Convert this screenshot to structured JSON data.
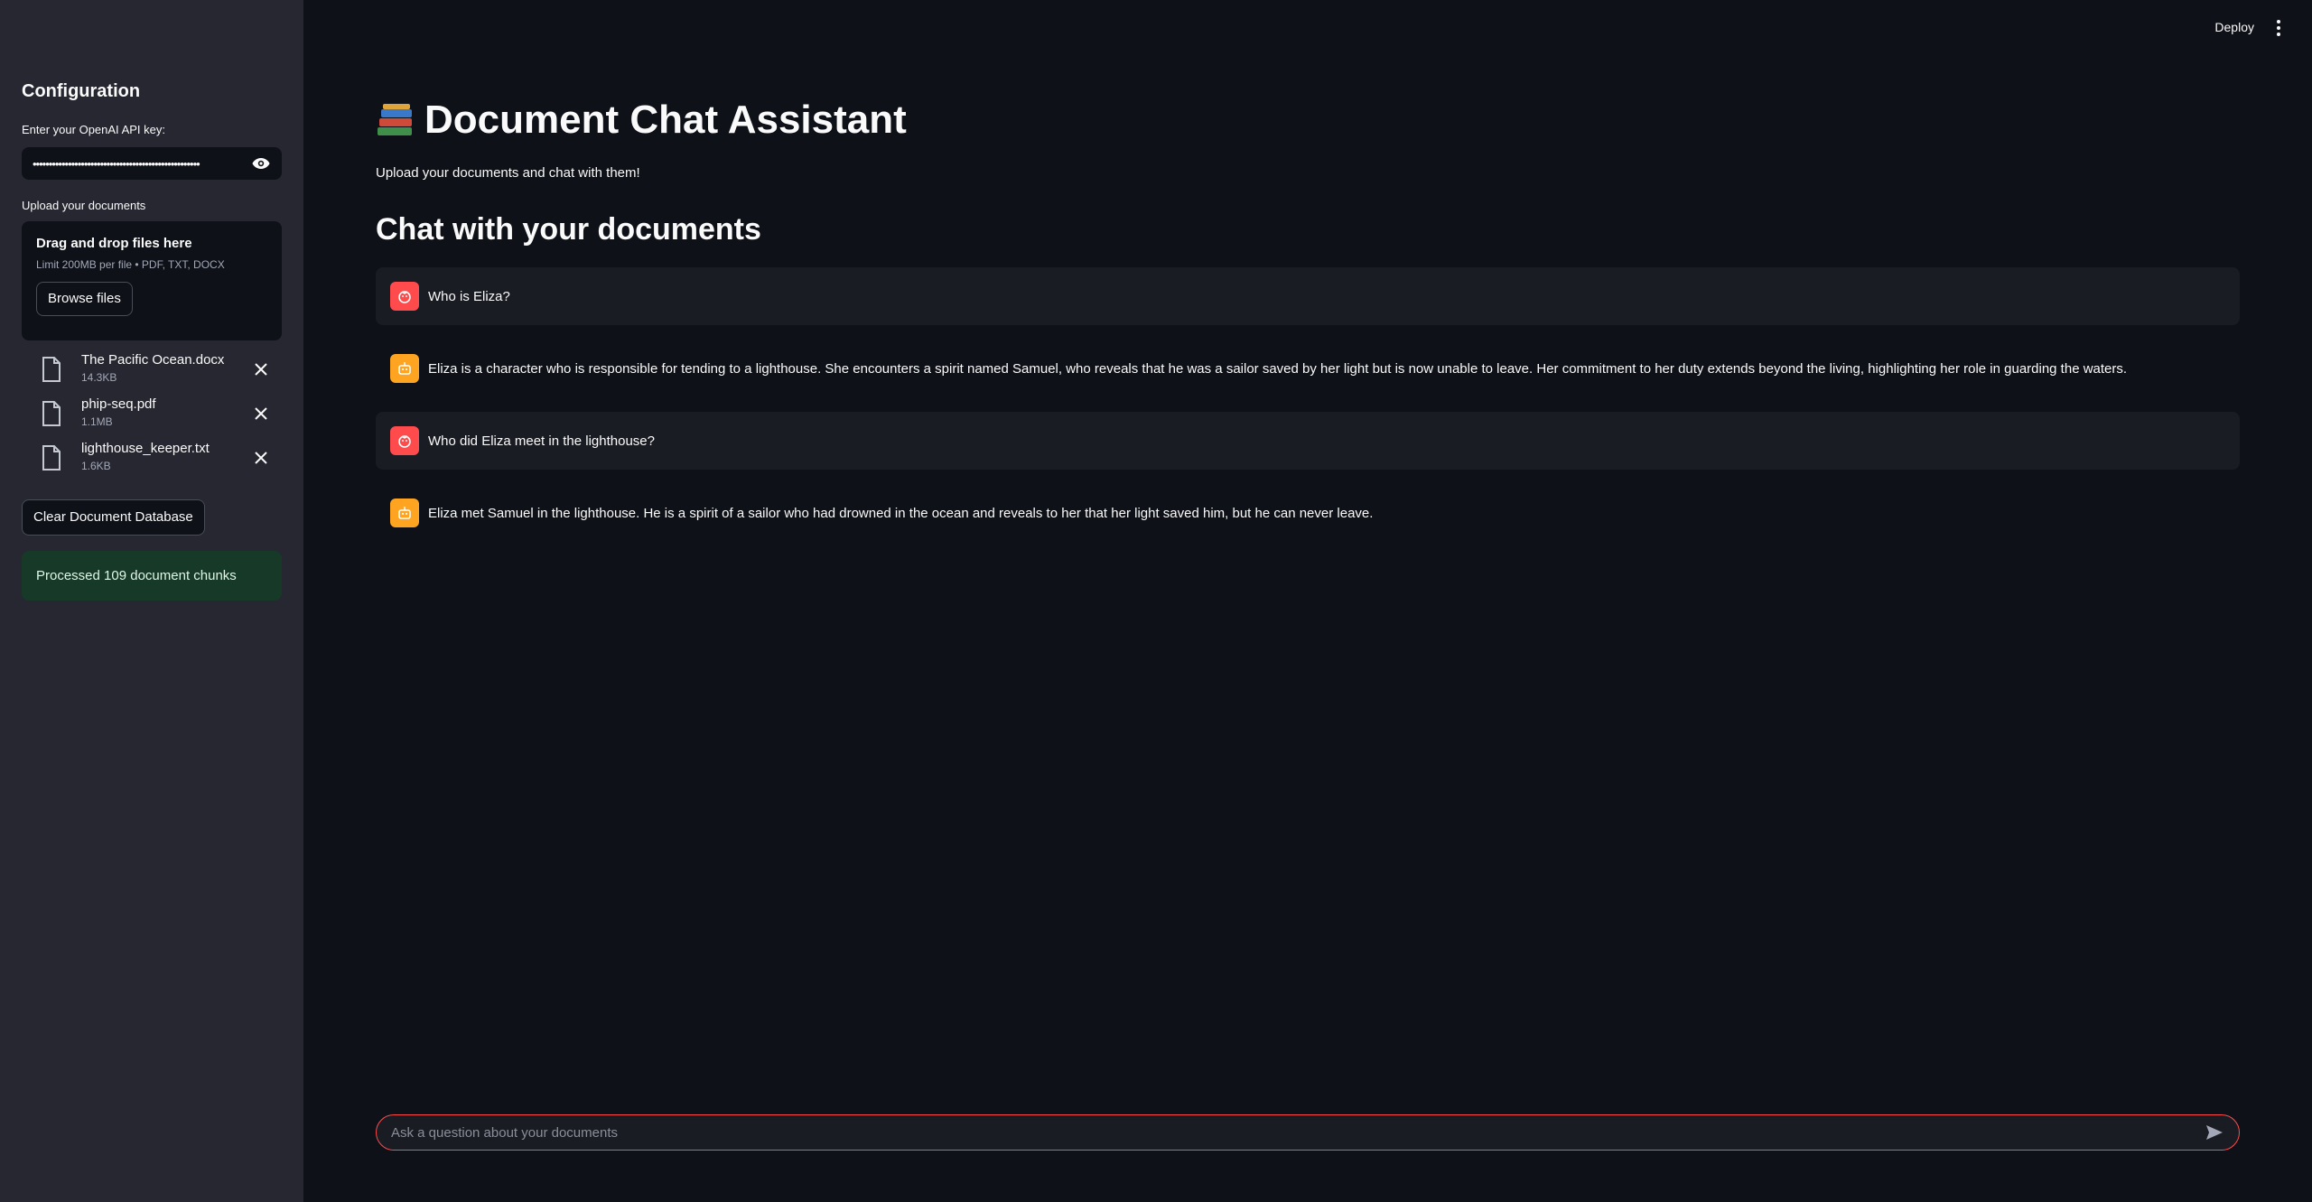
{
  "header": {
    "deploy_label": "Deploy",
    "menu_icon": "kebab-menu-icon"
  },
  "sidebar": {
    "title": "Configuration",
    "api_key_label": "Enter your OpenAI API key:",
    "api_key_value": "••••••••••••••••••••••••••••••••••••••••••••••••••••",
    "upload_label": "Upload your documents",
    "dropzone_title": "Drag and drop files here",
    "dropzone_limit": "Limit 200MB per file • PDF, TXT, DOCX",
    "browse_label": "Browse files",
    "files": [
      {
        "name": "The Pacific Ocean.docx",
        "size": "14.3KB"
      },
      {
        "name": "phip-seq.pdf",
        "size": "1.1MB"
      },
      {
        "name": "lighthouse_keeper.txt",
        "size": "1.6KB"
      }
    ],
    "clear_label": "Clear Document Database",
    "status": "Processed 109 document chunks"
  },
  "main": {
    "title": "Document Chat Assistant",
    "subtitle": "Upload your documents and chat with them!",
    "section_title": "Chat with your documents",
    "messages": [
      {
        "role": "user",
        "text": "Who is Eliza?"
      },
      {
        "role": "assistant",
        "text": "Eliza is a character who is responsible for tending to a lighthouse. She encounters a spirit named Samuel, who reveals that he was a sailor saved by her light but is now unable to leave. Her commitment to her duty extends beyond the living, highlighting her role in guarding the waters."
      },
      {
        "role": "user",
        "text": "Who did Eliza meet in the lighthouse?"
      },
      {
        "role": "assistant",
        "text": "Eliza met Samuel in the lighthouse. He is a spirit of a sailor who had drowned in the ocean and reveals to her that her light saved him, but he can never leave."
      }
    ],
    "chat_placeholder": "Ask a question about your documents"
  },
  "colors": {
    "accent": "#ff4b4b",
    "bot_avatar": "#ffa421",
    "success_bg": "#173928"
  }
}
